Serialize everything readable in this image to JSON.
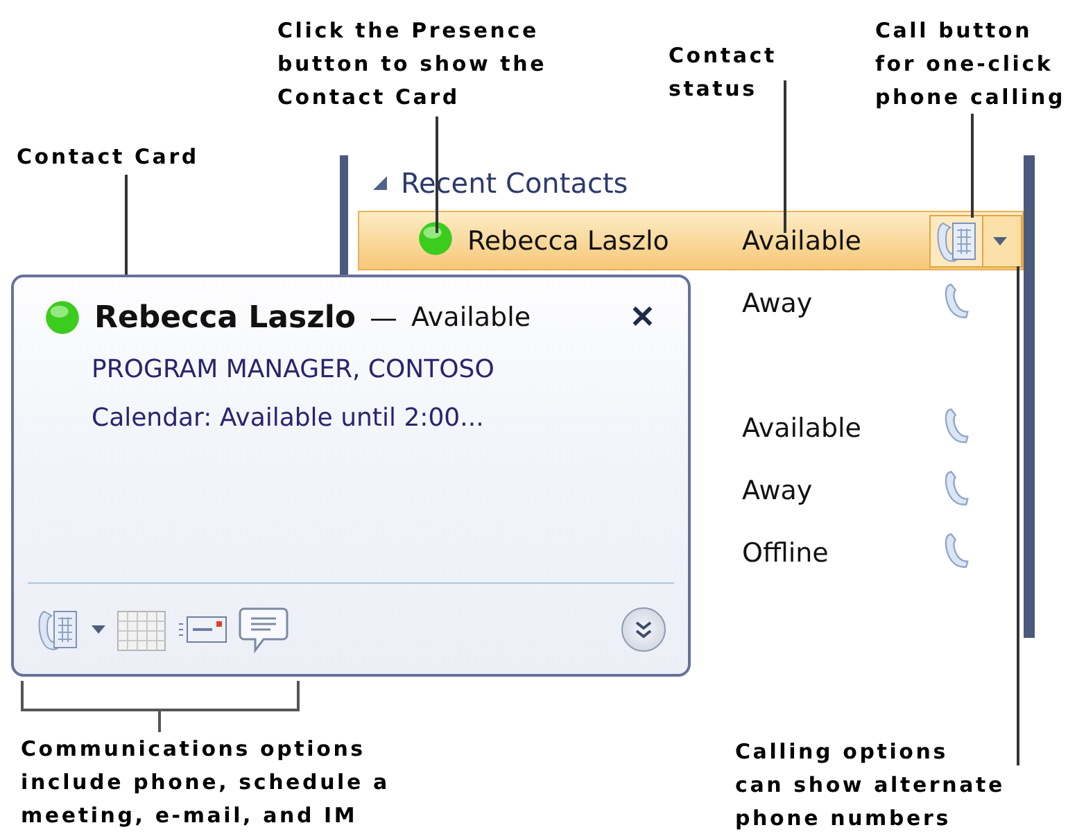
{
  "contact_list": {
    "header": "Recent Contacts",
    "expanded": true,
    "rows": [
      {
        "kind": "contact",
        "name": "Rebecca Laszlo",
        "status": "Available",
        "color": "#3ccc1e",
        "selected": true
      },
      {
        "kind": "contact",
        "status": "Away",
        "selected": false
      },
      {
        "kind": "blank"
      },
      {
        "kind": "contact",
        "status": "Available",
        "selected": false
      },
      {
        "kind": "contact",
        "status": "Away",
        "selected": false
      },
      {
        "kind": "contact",
        "status": "Offline",
        "selected": false
      }
    ]
  },
  "contact_card": {
    "color": "#3ccc1e",
    "name": "Rebecca Laszlo",
    "separator": "—",
    "status": "Available",
    "title": "PROGRAM MANAGER, CONTOSO",
    "calendar": "Calendar: Available until 2:00...",
    "close": "✕"
  },
  "callouts": [
    {
      "kind": "card",
      "lines": [
        "Contact Card"
      ]
    },
    {
      "kind": "presence",
      "lines": [
        "Click the Presence",
        "button to show the",
        "Contact Card"
      ]
    },
    {
      "kind": "status",
      "lines": [
        "Contact",
        "status"
      ]
    },
    {
      "kind": "call",
      "lines": [
        "Call button",
        "for one-click",
        "phone calling"
      ]
    },
    {
      "kind": "comms",
      "lines": [
        "Communications options",
        "include phone, schedule a",
        "meeting, e-mail, and IM"
      ]
    },
    {
      "kind": "options",
      "lines": [
        "Calling options",
        "can show alternate",
        "phone numbers"
      ]
    }
  ]
}
